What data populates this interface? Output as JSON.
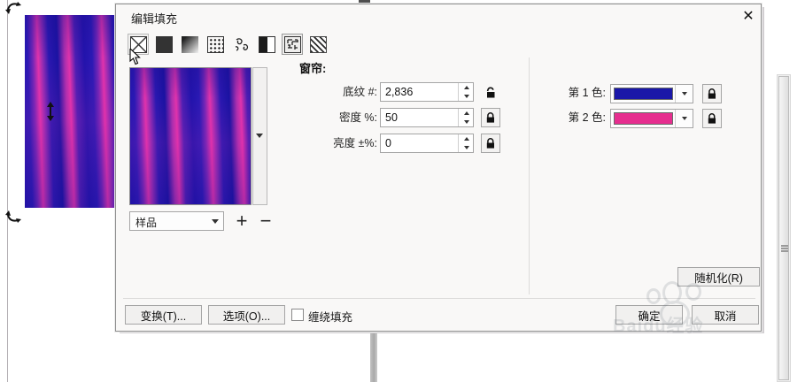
{
  "dialog": {
    "title": "编辑填充",
    "close_glyph": "✕"
  },
  "fill_types": {
    "items": [
      {
        "name": "no-fill",
        "state": "hovered"
      },
      {
        "name": "uniform-fill",
        "state": ""
      },
      {
        "name": "fountain-fill",
        "state": ""
      },
      {
        "name": "vector-pattern-fill",
        "state": ""
      },
      {
        "name": "bitmap-pattern-fill",
        "state": ""
      },
      {
        "name": "two-color-pattern-fill",
        "state": ""
      },
      {
        "name": "texture-fill",
        "state": "selected"
      },
      {
        "name": "postscript-fill",
        "state": ""
      }
    ]
  },
  "preview": {
    "sample_label": "样品",
    "plus_glyph": "+",
    "minus_glyph": "−"
  },
  "texture": {
    "group_label": "窗帘:",
    "params": [
      {
        "label": "底纹 #:",
        "value": "2,836",
        "locked": false
      },
      {
        "label": "密度 %:",
        "value": "50",
        "locked": true
      },
      {
        "label": "亮度 ±%:",
        "value": "0",
        "locked": true
      }
    ]
  },
  "colors": [
    {
      "label": "第 1 色:",
      "hex": "#1a17a8"
    },
    {
      "label": "第 2 色:",
      "hex": "#e62e8f"
    }
  ],
  "buttons": {
    "randomize": "随机化(R)",
    "transform": "变换(T)...",
    "options": "选项(O)...",
    "ok": "确定",
    "cancel": "取消"
  },
  "wrap_fill": {
    "label": "缠绕填充",
    "checked": false
  },
  "watermark": {
    "text": "Baidu经验"
  },
  "style": {
    "texture_blue": "#2213ac",
    "texture_magenta": "#e133ac"
  }
}
